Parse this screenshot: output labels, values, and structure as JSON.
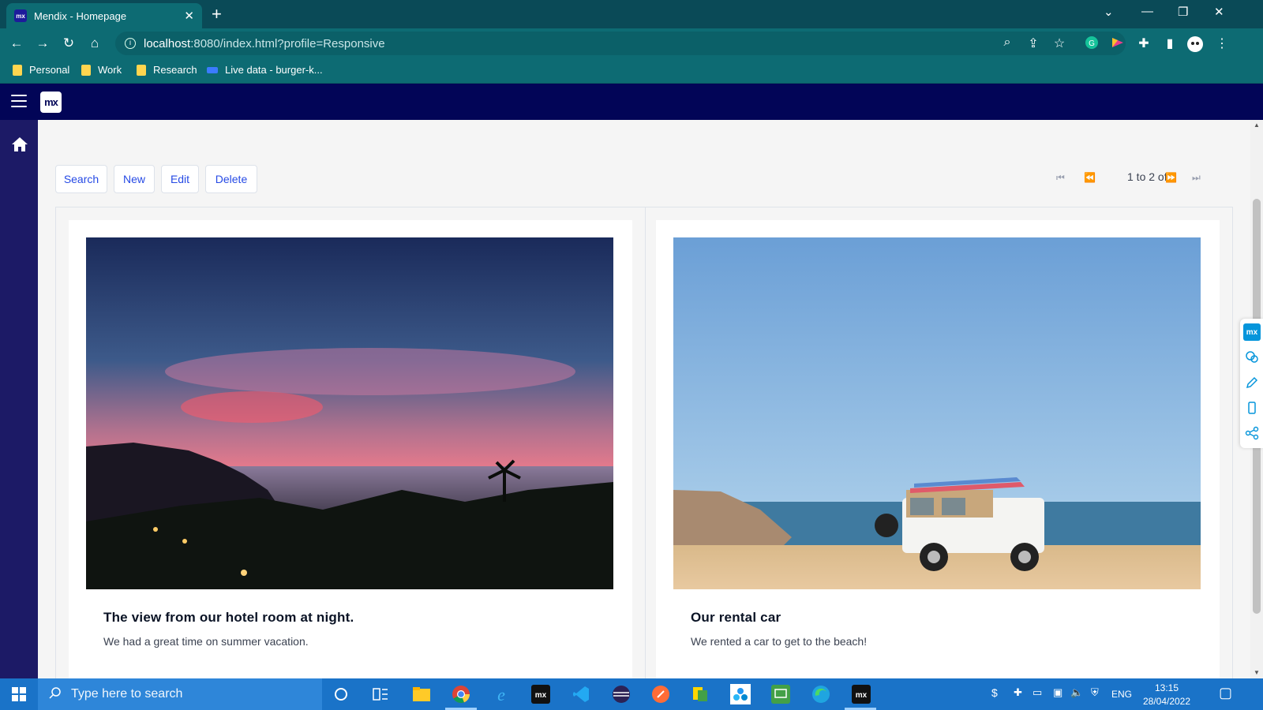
{
  "browser": {
    "tab_title": "Mendix - Homepage",
    "tab_close_icon": "close-icon",
    "new_tab_icon": "plus-icon",
    "url_host": "localhost",
    "url_rest": ":8080/index.html?profile=Responsive",
    "bookmarks": [
      {
        "label": "Personal",
        "icon": "folder-icon"
      },
      {
        "label": "Work",
        "icon": "folder-icon"
      },
      {
        "label": "Research",
        "icon": "folder-icon"
      },
      {
        "label": "Live data - burger-k...",
        "icon": "live-data-icon"
      }
    ]
  },
  "app": {
    "logo_text": "mx",
    "toolbar": {
      "search_label": "Search",
      "new_label": "New",
      "edit_label": "Edit",
      "delete_label": "Delete"
    },
    "pager": {
      "status": "1 to 2 of 2"
    },
    "cards": [
      {
        "title": "The view from our hotel room at night.",
        "description": "We had a great time on summer vacation."
      },
      {
        "title": "Our rental car",
        "description": "We rented a car to get to the beach!"
      }
    ],
    "dev_toolbar_logo": "mx"
  },
  "taskbar": {
    "search_placeholder": "Type here to search",
    "mx_label": "mx",
    "language": "ENG",
    "time": "13:15",
    "date": "28/04/2022"
  },
  "colors": {
    "app_header": "#020557",
    "sidebar": "#1c1a66",
    "button_text": "#264ae5",
    "browser_teal": "#0d6b73"
  }
}
